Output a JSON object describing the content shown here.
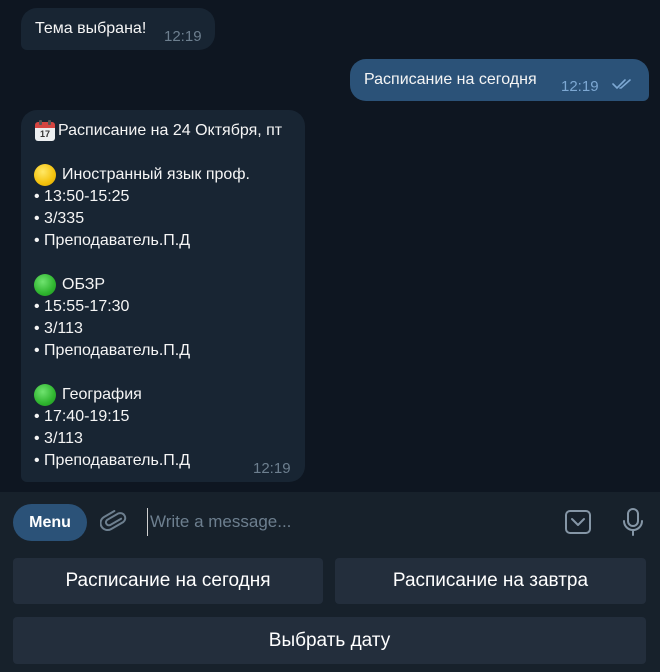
{
  "chat": {
    "messages": [
      {
        "direction": "incoming",
        "text": "Тема выбрана!",
        "time": "12:19"
      },
      {
        "direction": "outgoing",
        "text": "Расписание на сегодня",
        "time": "12:19",
        "status": "read"
      }
    ],
    "schedule": {
      "header": "Расписание на 24 Октября, пт",
      "calendar_day": "17",
      "lessons": [
        {
          "status_color": "yellow",
          "subject": "Иностранный язык проф.",
          "time": "• 13:50-15:25",
          "room": "• 3/335",
          "teacher": "• Преподаватель.П.Д"
        },
        {
          "status_color": "green",
          "subject": "ОБЗР",
          "time": "• 15:55-17:30",
          "room": "• 3/113",
          "teacher": "• Преподаватель.П.Д"
        },
        {
          "status_color": "green",
          "subject": "География",
          "time": "• 17:40-19:15",
          "room": "• 3/113",
          "teacher": "• Преподаватель.П.Д"
        }
      ],
      "time": "12:19"
    }
  },
  "composer": {
    "menu_label": "Menu",
    "placeholder": "Write a message..."
  },
  "keyboard": {
    "today": "Расписание на сегодня",
    "tomorrow": "Расписание на завтра",
    "pick_date": "Выбрать дату"
  },
  "colors": {
    "background": "#0e1621",
    "incoming_bubble": "#182533",
    "outgoing_bubble": "#2b5278",
    "composer": "#17212b",
    "keyboard_button": "#232e3c"
  }
}
